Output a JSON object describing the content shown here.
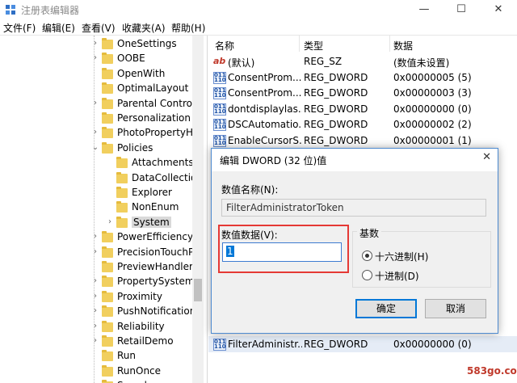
{
  "window": {
    "title": "注册表编辑器",
    "minimize": "—",
    "maximize": "☐",
    "close": "✕"
  },
  "menu": [
    "文件(F)",
    "编辑(E)",
    "查看(V)",
    "收藏夹(A)",
    "帮助(H)"
  ],
  "tree": [
    {
      "label": "OneSettings",
      "expander": "›",
      "level": 1
    },
    {
      "label": "OOBE",
      "expander": "›",
      "level": 1
    },
    {
      "label": "OpenWith",
      "expander": "",
      "level": 1
    },
    {
      "label": "OptimalLayout",
      "expander": "",
      "level": 1
    },
    {
      "label": "Parental Controls",
      "expander": "›",
      "level": 1
    },
    {
      "label": "Personalization",
      "expander": "",
      "level": 1
    },
    {
      "label": "PhotoPropertyHa",
      "expander": "›",
      "level": 1
    },
    {
      "label": "Policies",
      "expander": "⌄",
      "level": 1
    },
    {
      "label": "Attachments",
      "expander": "",
      "level": 2
    },
    {
      "label": "DataCollection",
      "expander": "",
      "level": 2
    },
    {
      "label": "Explorer",
      "expander": "",
      "level": 2
    },
    {
      "label": "NonEnum",
      "expander": "",
      "level": 2
    },
    {
      "label": "System",
      "expander": "›",
      "level": 2,
      "selected": true
    },
    {
      "label": "PowerEfficiencyDi",
      "expander": "›",
      "level": 1
    },
    {
      "label": "PrecisionTouchPa",
      "expander": "›",
      "level": 1
    },
    {
      "label": "PreviewHandlers",
      "expander": "",
      "level": 1
    },
    {
      "label": "PropertySystem",
      "expander": "›",
      "level": 1
    },
    {
      "label": "Proximity",
      "expander": "›",
      "level": 1
    },
    {
      "label": "PushNotifications",
      "expander": "›",
      "level": 1
    },
    {
      "label": "Reliability",
      "expander": "›",
      "level": 1
    },
    {
      "label": "RetailDemo",
      "expander": "›",
      "level": 1
    },
    {
      "label": "Run",
      "expander": "",
      "level": 1
    },
    {
      "label": "RunOnce",
      "expander": "",
      "level": 1
    },
    {
      "label": "Search",
      "expander": "›",
      "level": 1
    }
  ],
  "list": {
    "headers": [
      "名称",
      "类型",
      "数据"
    ],
    "rows": [
      {
        "icon": "ab",
        "name": "(默认)",
        "type": "REG_SZ",
        "data": "(数值未设置)"
      },
      {
        "icon": "dword",
        "name": "ConsentProm...",
        "type": "REG_DWORD",
        "data": "0x00000005 (5)"
      },
      {
        "icon": "dword",
        "name": "ConsentProm...",
        "type": "REG_DWORD",
        "data": "0x00000003 (3)"
      },
      {
        "icon": "dword",
        "name": "dontdisplaylas...",
        "type": "REG_DWORD",
        "data": "0x00000000 (0)"
      },
      {
        "icon": "dword",
        "name": "DSCAutomatio...",
        "type": "REG_DWORD",
        "data": "0x00000002 (2)"
      },
      {
        "icon": "dword",
        "name": "EnableCursorS...",
        "type": "REG_DWORD",
        "data": "0x00000001 (1)"
      }
    ],
    "bottom_row": {
      "icon": "dword",
      "name": "FilterAdministr...",
      "type": "REG_DWORD",
      "data": "0x00000000 (0)"
    }
  },
  "dialog": {
    "title": "编辑 DWORD (32 位)值",
    "close": "✕",
    "name_label": "数值名称(N):",
    "name_value": "FilterAdministratorToken",
    "value_label": "数值数据(V):",
    "value_value": "1",
    "base_label": "基数",
    "radio_hex": "十六进制(H)",
    "radio_dec": "十进制(D)",
    "ok": "确定",
    "cancel": "取消"
  },
  "watermark": "583go.com",
  "icons": {
    "app": "registry-icon",
    "dword_glyph": "011\n110",
    "ab_glyph": "ab"
  }
}
